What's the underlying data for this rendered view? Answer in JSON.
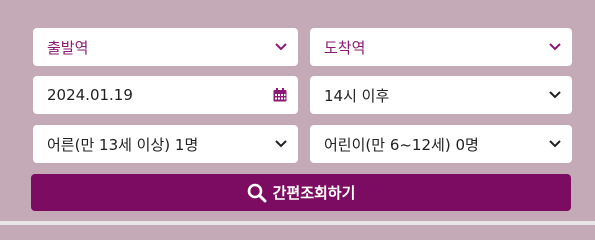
{
  "form": {
    "departure": {
      "value": "출발역",
      "icon": "chevron-down-icon"
    },
    "arrival": {
      "value": "도착역",
      "icon": "chevron-down-icon"
    },
    "date": {
      "value": "2024.01.19",
      "icon": "calendar-icon"
    },
    "time": {
      "value": "14시 이후",
      "icon": "chevron-down-icon"
    },
    "adults": {
      "value": "어른(만 13세 이상) 1명",
      "icon": "chevron-down-icon"
    },
    "children": {
      "value": "어린이(만 6~12세) 0명",
      "icon": "chevron-down-icon"
    },
    "search_button": {
      "label": "간편조회하기",
      "icon": "search-icon"
    }
  },
  "colors": {
    "background": "#c4a9b6",
    "accent": "#7b0c62",
    "station_text": "#8a1a75"
  }
}
